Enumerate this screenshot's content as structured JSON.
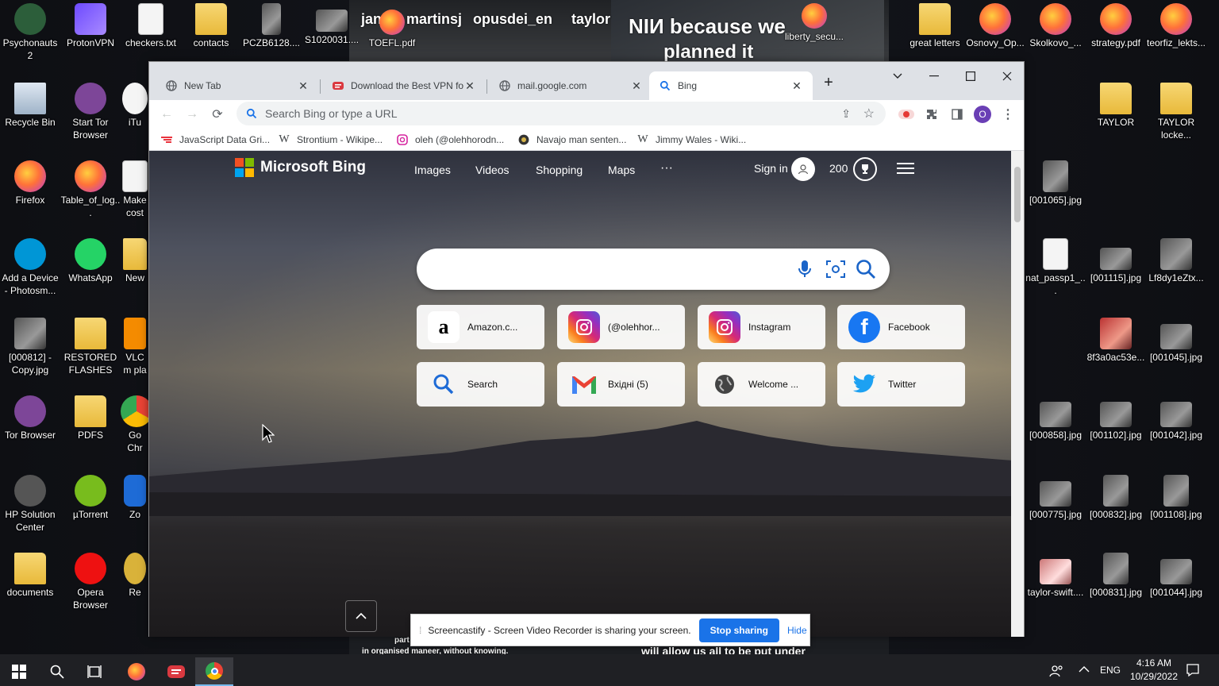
{
  "desktop": {
    "overlay": {
      "line1": "NIИ because we",
      "line2": "planned it",
      "names": [
        "jan",
        "martinsj",
        "opusdei_en",
        "taylor"
      ],
      "bottom_left": "part",
      "bottom_left2": "in organised maneer, without knowing.",
      "bottom_right": "will allow us all to be put under"
    },
    "left_icons": [
      {
        "label": "Psychonauts 2"
      },
      {
        "label": "ProtonVPN"
      },
      {
        "label": "checkers.txt"
      },
      {
        "label": "contacts"
      },
      {
        "label": "PCZB6128...."
      },
      {
        "label": "S1020031...."
      },
      {
        "label": "TOEFL.pdf"
      },
      {
        "label": "Recycle Bin"
      },
      {
        "label": "Start Tor Browser"
      },
      {
        "label": "iTu"
      },
      {
        "label": "Firefox"
      },
      {
        "label": "Table_of_log..."
      },
      {
        "label": "Make cost"
      },
      {
        "label": "Add a Device - Photosm..."
      },
      {
        "label": "WhatsApp"
      },
      {
        "label": "New"
      },
      {
        "label": "[000812] - Copy.jpg"
      },
      {
        "label": "RESTORED FLASHES"
      },
      {
        "label": "VLC m pla"
      },
      {
        "label": "Tor Browser"
      },
      {
        "label": "PDFS"
      },
      {
        "label": "Go Chr"
      },
      {
        "label": "HP Solution Center"
      },
      {
        "label": "µTorrent"
      },
      {
        "label": "Zo"
      },
      {
        "label": "documents"
      },
      {
        "label": "Opera Browser"
      },
      {
        "label": "Re"
      }
    ],
    "right_icons": [
      {
        "label": "liberty_secu..."
      },
      {
        "label": "great letters"
      },
      {
        "label": "Osnovy_Op..."
      },
      {
        "label": "Skolkovo_..."
      },
      {
        "label": "strategy.pdf"
      },
      {
        "label": "teorfiz_lekts..."
      },
      {
        "label": "TAYLOR"
      },
      {
        "label": "TAYLOR locke..."
      },
      {
        "label": "[001065].jpg"
      },
      {
        "label": "nat_passp1_..."
      },
      {
        "label": "[001115].jpg"
      },
      {
        "label": "Lf8dy1eZtx..."
      },
      {
        "label": "8f3a0ac53e..."
      },
      {
        "label": "[001045].jpg"
      },
      {
        "label": "[000858].jpg"
      },
      {
        "label": "[001102].jpg"
      },
      {
        "label": "[001042].jpg"
      },
      {
        "label": "[000775].jpg"
      },
      {
        "label": "[000832].jpg"
      },
      {
        "label": "[001108].jpg"
      },
      {
        "label": "taylor-swift...."
      },
      {
        "label": "[000831].jpg"
      },
      {
        "label": "[001044].jpg"
      }
    ]
  },
  "browser": {
    "tabs": [
      {
        "title": "New Tab",
        "icon": "globe-icon"
      },
      {
        "title": "Download the Best VPN fo",
        "icon": "expressvpn-icon"
      },
      {
        "title": "mail.google.com",
        "icon": "globe-icon"
      },
      {
        "title": "Bing",
        "icon": "search-icon"
      }
    ],
    "omnibox_placeholder": "Search Bing or type a URL",
    "profile_initial": "O",
    "bookmarks": [
      {
        "label": "JavaScript Data Gri..."
      },
      {
        "label": "Strontium - Wikipe..."
      },
      {
        "label": "oleh (@olehhorodn..."
      },
      {
        "label": "Navajo man senten..."
      },
      {
        "label": "Jimmy Wales - Wiki..."
      }
    ]
  },
  "bing": {
    "brand": "Microsoft Bing",
    "nav": [
      "Images",
      "Videos",
      "Shopping",
      "Maps",
      "···"
    ],
    "sign_in": "Sign in",
    "points": "200",
    "tiles": [
      {
        "label": "Amazon.c...",
        "icon": "amazon-icon",
        "color": "#000000"
      },
      {
        "label": "(@olehhor...",
        "icon": "instagram-icon",
        "color": "#e1306c"
      },
      {
        "label": "Instagram",
        "icon": "instagram-icon",
        "color": "#e1306c"
      },
      {
        "label": "Facebook",
        "icon": "facebook-icon",
        "color": "#1877f2"
      },
      {
        "label": "Search",
        "icon": "search-icon",
        "color": "#1e6bd6"
      },
      {
        "label": "Вхідні (5)",
        "icon": "gmail-icon",
        "color": "#ea4335"
      },
      {
        "label": "Welcome ...",
        "icon": "globe-icon",
        "color": "#444444"
      },
      {
        "label": "Twitter",
        "icon": "twitter-icon",
        "color": "#1da1f2"
      }
    ]
  },
  "share_bar": {
    "message": "Screencastify - Screen Video Recorder is sharing your screen.",
    "stop_label": "Stop sharing",
    "hide_label": "Hide"
  },
  "taskbar": {
    "language": "ENG",
    "time": "4:16 AM",
    "date": "10/29/2022"
  }
}
